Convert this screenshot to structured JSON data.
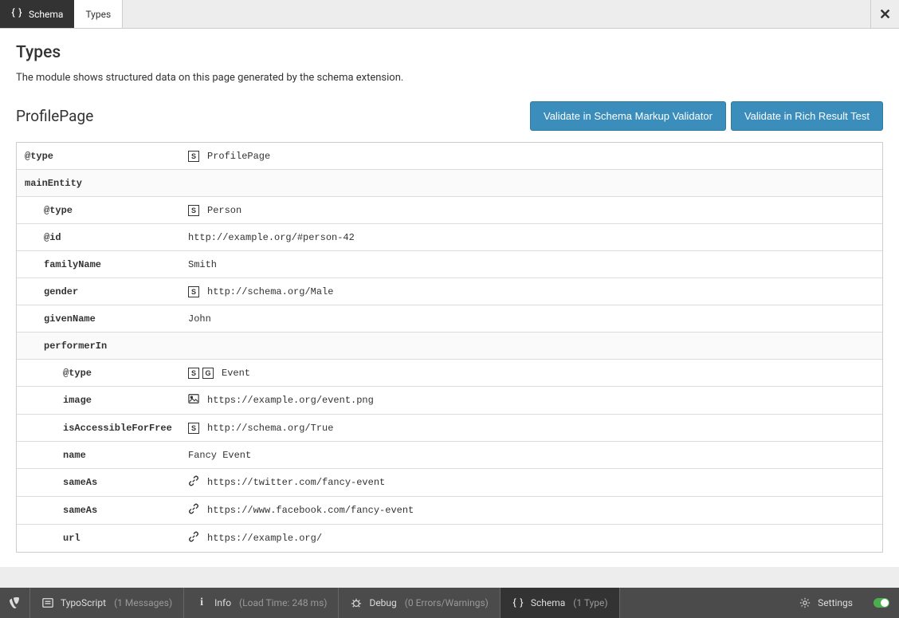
{
  "tabs": {
    "schema": "Schema",
    "types": "Types"
  },
  "header": {
    "title": "Types",
    "description": "The module shows structured data on this page generated by the schema extension."
  },
  "section": {
    "title": "ProfilePage",
    "validate_markup_btn": "Validate in Schema Markup Validator",
    "validate_rich_btn": "Validate in Rich Result Test"
  },
  "rows": [
    {
      "indent": 0,
      "key": "@type",
      "icons": [
        "s"
      ],
      "value": "ProfilePage"
    },
    {
      "indent": 0,
      "key": "mainEntity",
      "header": true
    },
    {
      "indent": 1,
      "key": "@type",
      "icons": [
        "s"
      ],
      "value": "Person"
    },
    {
      "indent": 1,
      "key": "@id",
      "value": "http://example.org/#person-42"
    },
    {
      "indent": 1,
      "key": "familyName",
      "value": "Smith"
    },
    {
      "indent": 1,
      "key": "gender",
      "icons": [
        "s"
      ],
      "value": "http://schema.org/Male"
    },
    {
      "indent": 1,
      "key": "givenName",
      "value": "John"
    },
    {
      "indent": 1,
      "key": "performerIn",
      "header": true
    },
    {
      "indent": 2,
      "key": "@type",
      "icons": [
        "s",
        "g"
      ],
      "value": "Event"
    },
    {
      "indent": 2,
      "key": "image",
      "icons": [
        "img"
      ],
      "value": "https://example.org/event.png"
    },
    {
      "indent": 2,
      "key": "isAccessibleForFree",
      "icons": [
        "s"
      ],
      "value": "http://schema.org/True"
    },
    {
      "indent": 2,
      "key": "name",
      "value": "Fancy Event"
    },
    {
      "indent": 2,
      "key": "sameAs",
      "icons": [
        "link"
      ],
      "value": "https://twitter.com/fancy-event"
    },
    {
      "indent": 2,
      "key": "sameAs",
      "icons": [
        "link"
      ],
      "value": "https://www.facebook.com/fancy-event"
    },
    {
      "indent": 2,
      "key": "url",
      "icons": [
        "link"
      ],
      "value": "https://example.org/"
    }
  ],
  "statusbar": {
    "typoscript": {
      "label": "TypoScript",
      "suffix": "(1 Messages)"
    },
    "info": {
      "label": "Info",
      "suffix": "(Load Time: 248 ms)"
    },
    "debug": {
      "label": "Debug",
      "suffix": "(0 Errors/Warnings)"
    },
    "schema": {
      "label": "Schema",
      "suffix": "(1 Type)"
    },
    "settings": "Settings"
  }
}
